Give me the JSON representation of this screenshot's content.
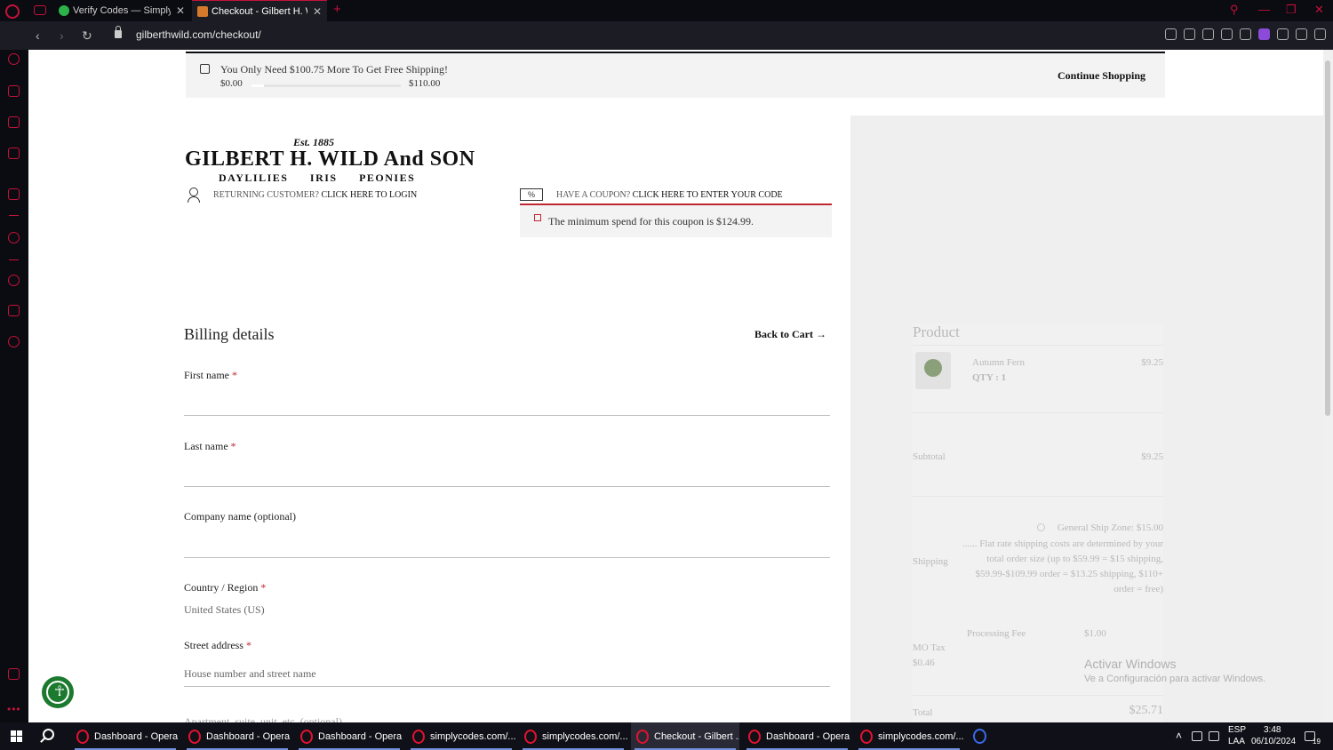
{
  "browser": {
    "tabs": [
      {
        "title": "Verify Codes — SimplyCod",
        "active": false
      },
      {
        "title": "Checkout - Gilbert H. Wild",
        "active": true
      }
    ],
    "url": "gilberthwild.com/checkout/"
  },
  "notice": {
    "text": "You Only Need $100.75 More To Get Free Shipping!",
    "min": "$0.00",
    "max": "$110.00",
    "progress": 0.084,
    "continue_label": "Continue Shopping"
  },
  "logo": {
    "est": "Est. 1885",
    "name": "GILBERT H. WILD And SON",
    "flowers": "DAYLILIES IRIS PEONIES"
  },
  "returning": {
    "prefix": "RETURNING CUSTOMER?",
    "link": "CLICK HERE TO LOGIN"
  },
  "coupon": {
    "icon_text": "%",
    "prefix": "HAVE A COUPON?",
    "link": "CLICK HERE TO ENTER YOUR CODE",
    "error": "The minimum spend for this coupon is $124.99."
  },
  "billing": {
    "title": "Billing details",
    "back_label": "Back to Cart",
    "back_arrow": "→",
    "required_mark": "*",
    "fields": {
      "first_name": "First name",
      "last_name": "Last name",
      "company": "Company name (optional)",
      "country": "Country / Region",
      "country_value": "United States (US)",
      "street": "Street address",
      "street_placeholder": "House number and street name",
      "apartment_placeholder": "Apartment, suite, unit, etc. (optional)"
    }
  },
  "order": {
    "product_heading": "Product",
    "item_name": "Autumn Fern",
    "item_qty": "QTY : 1",
    "item_price": "$9.25",
    "subtotal_label": "Subtotal",
    "subtotal_value": "$9.25",
    "shipping_label": "Shipping",
    "shipping_option": "General Ship Zone: $15.00",
    "shipping_desc": "...... Flat rate shipping costs are determined by your total order size (up to $59.99 = $15 shipping, $59.99-$109.99 order = $13.25 shipping, $110+ order = free)",
    "fee_label": "Processing Fee",
    "fee_value": "$1.00",
    "tax_label": "MO Tax",
    "tax_value": "$0.46",
    "total_label": "Total",
    "total_value": "$25.71"
  },
  "watermark": {
    "line1": "Activar Windows",
    "line2": "Ve a Configuración para activar Windows."
  },
  "taskbar": {
    "items": [
      {
        "label": "Dashboard - Opera",
        "active": false
      },
      {
        "label": "Dashboard - Opera",
        "active": false
      },
      {
        "label": "Dashboard - Opera",
        "active": false
      },
      {
        "label": "simplycodes.com/...",
        "active": false
      },
      {
        "label": "simplycodes.com/...",
        "active": false
      },
      {
        "label": "Checkout - Gilbert ...",
        "active": true
      },
      {
        "label": "Dashboard - Opera",
        "active": false
      },
      {
        "label": "simplycodes.com/...",
        "active": false
      }
    ],
    "lang": "ESP",
    "lang2": "LAA",
    "time": "3:48",
    "date": "06/10/2024",
    "notif_count": "19"
  },
  "colors": {
    "opera_red": "#c4123a",
    "coupon_red": "#c0262e",
    "a11y_green": "#1b7a2e"
  }
}
